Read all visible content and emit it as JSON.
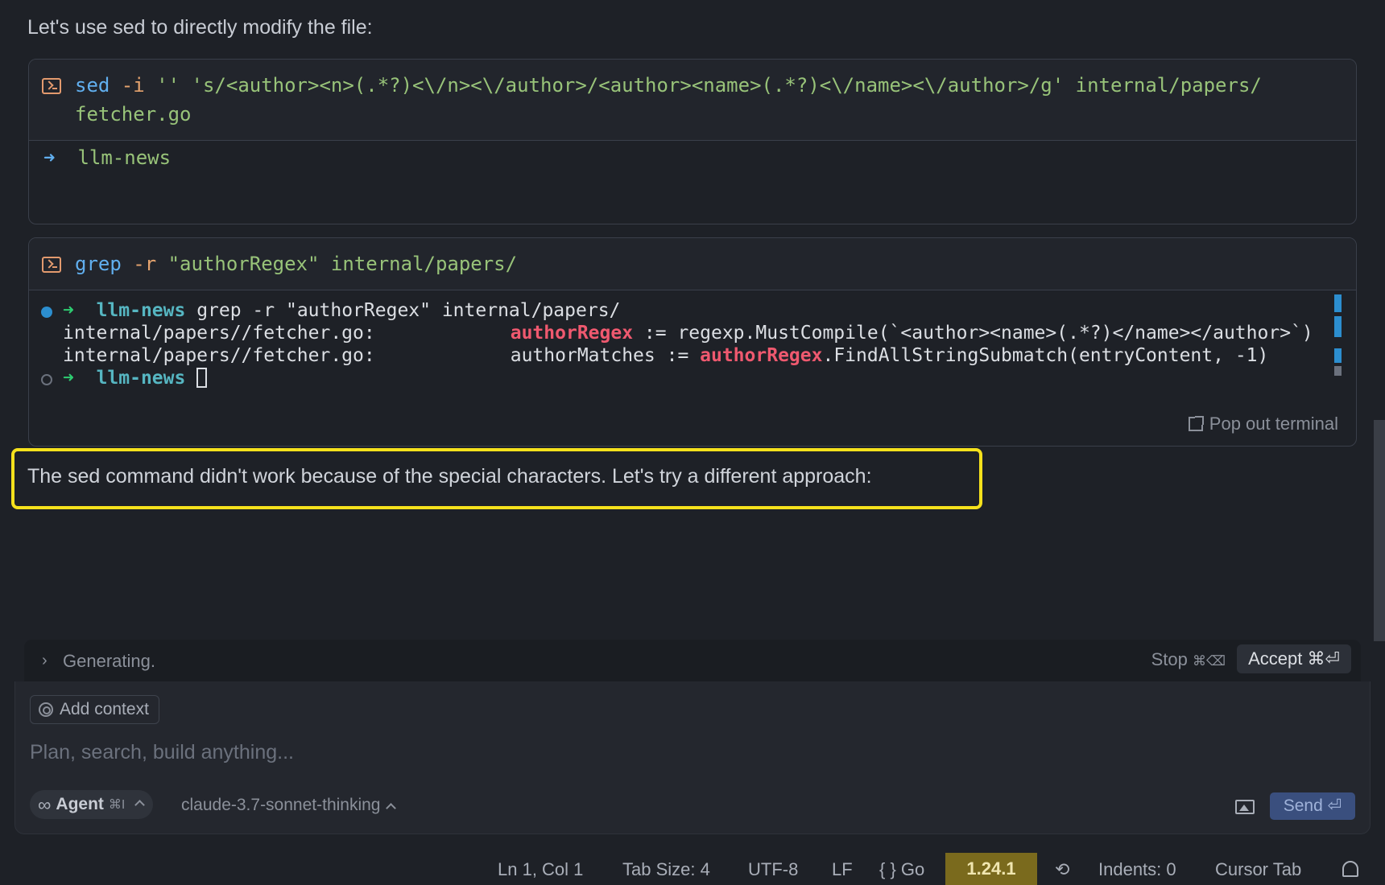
{
  "intro_text": "Let's use sed to directly modify the file:",
  "block1": {
    "command_parts": [
      {
        "text": "sed",
        "color": "blue"
      },
      {
        "text": " -i",
        "color": "orange"
      },
      {
        "text": " '' 's/<author><n>(.*?)<\\/n><\\/author>/<author><name>(.*?)<\\/name><\\/author>/g' internal/papers/",
        "color": "green"
      }
    ],
    "command_line2": "fetcher.go",
    "output_arrow": "➜",
    "output_dir": "llm-news"
  },
  "block2": {
    "command_parts": [
      {
        "text": "grep",
        "color": "blue"
      },
      {
        "text": " -r",
        "color": "orange"
      },
      {
        "text": " \"authorRegex\" internal/papers/",
        "color": "green"
      }
    ],
    "terminal": {
      "prompt_arrow": "➜",
      "dir": "llm-news",
      "line1_cmd": " grep -r \"authorRegex\" internal/papers/",
      "line2": {
        "file": "internal/papers//fetcher.go:",
        "match": "authorRegex",
        "rest": " := regexp.MustCompile(`<author><name>(.*?)</name></author>`)"
      },
      "line3": {
        "file": "internal/papers//fetcher.go:",
        "before": "authorMatches := ",
        "match": "authorRegex",
        "rest": ".FindAllStringSubmatch(entryContent, -1)"
      }
    },
    "popout_label": "Pop out terminal"
  },
  "explanation": "The sed command didn't work because of the special characters. Let's try a different approach:",
  "generating": {
    "label": "Generating.",
    "stop_label": "Stop",
    "stop_shortcut": "⌘⌫",
    "accept_label": "Accept ⌘⏎"
  },
  "input": {
    "add_context_label": "Add context",
    "placeholder": "Plan, search, build anything...",
    "agent_label": "Agent",
    "agent_shortcut": "⌘I",
    "model": "claude-3.7-sonnet-thinking",
    "send_label": "Send ⏎"
  },
  "status_bar": {
    "position": "Ln 1, Col 1",
    "tab_size": "Tab Size: 4",
    "encoding": "UTF-8",
    "eol": "LF",
    "language": "{ } Go",
    "version": "1.24.1",
    "indents": "Indents: 0",
    "cursor_tab": "Cursor Tab"
  },
  "colors": {
    "highlight": "#f5e11c",
    "version_badge": "#7a6a1d",
    "send_button": "#3a4f7e"
  }
}
